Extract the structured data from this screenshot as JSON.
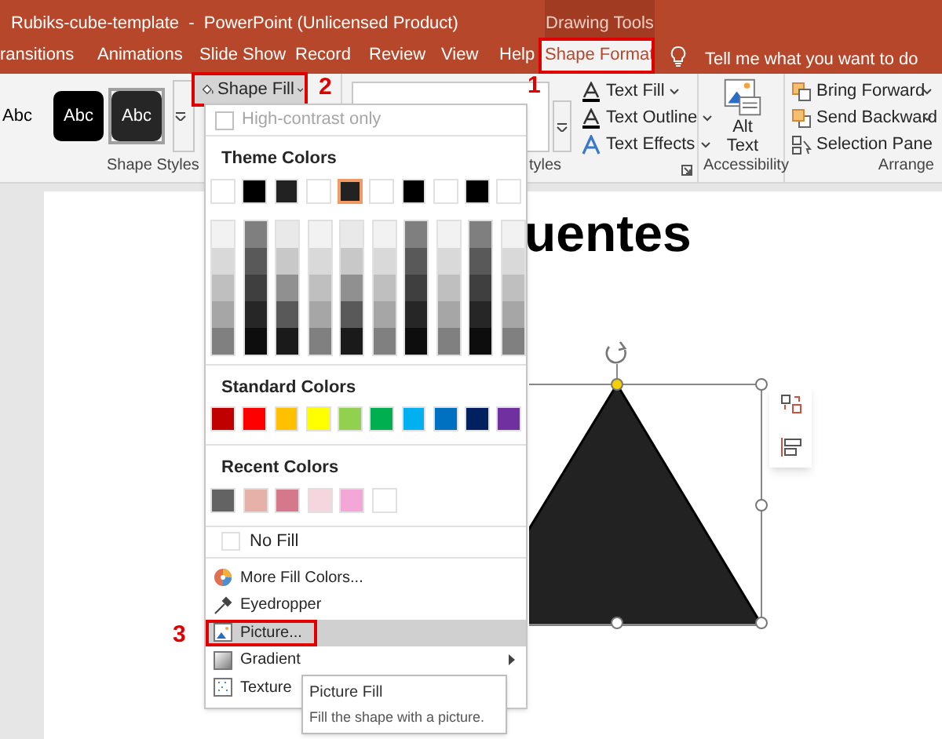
{
  "window": {
    "title": "Rubiks-cube-template  -  PowerPoint (Unlicensed Product)",
    "context_group": "Drawing Tools"
  },
  "tabs": [
    {
      "label": "ransitions",
      "selected": false,
      "annotated": false
    },
    {
      "label": "Animations",
      "selected": false,
      "annotated": false
    },
    {
      "label": "Slide Show",
      "selected": false,
      "annotated": false
    },
    {
      "label": "Record",
      "selected": false,
      "annotated": false
    },
    {
      "label": "Review",
      "selected": false,
      "annotated": false
    },
    {
      "label": "View",
      "selected": false,
      "annotated": false
    },
    {
      "label": "Help",
      "selected": false,
      "annotated": false
    },
    {
      "label": "Shape Format",
      "selected": true,
      "annotated": true
    }
  ],
  "tell_me": "Tell me what you want to do",
  "ribbon": {
    "shape_styles": {
      "label": "Shape Styles",
      "styles": [
        {
          "label": "Abc",
          "selected": false,
          "kind": "plain"
        },
        {
          "label": "Abc",
          "selected": false,
          "kind": "dark"
        },
        {
          "label": "Abc",
          "selected": true,
          "kind": "dark"
        }
      ],
      "shape_fill": {
        "label": "Shape Fill",
        "annotated": true
      }
    },
    "wordart": {
      "label": "tyles",
      "buttons": [
        "Text Fill",
        "Text Outline",
        "Text Effects"
      ]
    },
    "accessibility": {
      "label": "Accessibility",
      "alt_text": [
        "Alt",
        "Text"
      ]
    },
    "arrange": {
      "label": "Arrange",
      "buttons": [
        {
          "label": "Bring Forward",
          "dropdown": true
        },
        {
          "label": "Send Backward",
          "dropdown": true
        },
        {
          "label": "Selection Pane",
          "dropdown": false
        }
      ]
    }
  },
  "annotations": [
    {
      "label": "1"
    },
    {
      "label": "2"
    },
    {
      "label": "3"
    }
  ],
  "fill_menu": {
    "high_contrast": {
      "label": "High-contrast only",
      "checked": false,
      "disabled": true
    },
    "theme_heading": "Theme Colors",
    "theme_colors": [
      {
        "color": "#ffffff",
        "selected": false,
        "shades": [
          {
            "color": "#f2f2f2"
          },
          {
            "color": "#d9d9d9"
          },
          {
            "color": "#bfbfbf"
          },
          {
            "color": "#a6a6a6"
          },
          {
            "color": "#808080"
          }
        ]
      },
      {
        "color": "#000000",
        "selected": false,
        "shades": [
          {
            "color": "#7f7f7f"
          },
          {
            "color": "#595959"
          },
          {
            "color": "#3f3f3f"
          },
          {
            "color": "#262626"
          },
          {
            "color": "#0d0d0d"
          }
        ]
      },
      {
        "color": "#222222",
        "selected": false,
        "shades": [
          {
            "color": "#e9e9e9"
          },
          {
            "color": "#c8c8c8"
          },
          {
            "color": "#909090"
          },
          {
            "color": "#595959"
          },
          {
            "color": "#1a1a1a"
          }
        ]
      },
      {
        "color": "#ffffff",
        "selected": false,
        "shades": [
          {
            "color": "#f2f2f2"
          },
          {
            "color": "#d9d9d9"
          },
          {
            "color": "#bfbfbf"
          },
          {
            "color": "#a6a6a6"
          },
          {
            "color": "#808080"
          }
        ]
      },
      {
        "color": "#222222",
        "selected": true,
        "shades": [
          {
            "color": "#e9e9e9"
          },
          {
            "color": "#c8c8c8"
          },
          {
            "color": "#909090"
          },
          {
            "color": "#595959"
          },
          {
            "color": "#1a1a1a"
          }
        ]
      },
      {
        "color": "#ffffff",
        "selected": false,
        "shades": [
          {
            "color": "#f2f2f2"
          },
          {
            "color": "#d9d9d9"
          },
          {
            "color": "#bfbfbf"
          },
          {
            "color": "#a6a6a6"
          },
          {
            "color": "#808080"
          }
        ]
      },
      {
        "color": "#000000",
        "selected": false,
        "shades": [
          {
            "color": "#7f7f7f"
          },
          {
            "color": "#595959"
          },
          {
            "color": "#3f3f3f"
          },
          {
            "color": "#262626"
          },
          {
            "color": "#0d0d0d"
          }
        ]
      },
      {
        "color": "#ffffff",
        "selected": false,
        "shades": [
          {
            "color": "#f2f2f2"
          },
          {
            "color": "#d9d9d9"
          },
          {
            "color": "#bfbfbf"
          },
          {
            "color": "#a6a6a6"
          },
          {
            "color": "#808080"
          }
        ]
      },
      {
        "color": "#000000",
        "selected": false,
        "shades": [
          {
            "color": "#7f7f7f"
          },
          {
            "color": "#595959"
          },
          {
            "color": "#3f3f3f"
          },
          {
            "color": "#262626"
          },
          {
            "color": "#0d0d0d"
          }
        ]
      },
      {
        "color": "#ffffff",
        "selected": false,
        "shades": [
          {
            "color": "#f2f2f2"
          },
          {
            "color": "#d9d9d9"
          },
          {
            "color": "#bfbfbf"
          },
          {
            "color": "#a6a6a6"
          },
          {
            "color": "#808080"
          }
        ]
      }
    ],
    "standard_heading": "Standard Colors",
    "standard_colors": [
      {
        "color": "#c00000"
      },
      {
        "color": "#ff0000"
      },
      {
        "color": "#ffc000"
      },
      {
        "color": "#ffff00"
      },
      {
        "color": "#92d050"
      },
      {
        "color": "#00b050"
      },
      {
        "color": "#00b0f0"
      },
      {
        "color": "#0070c0"
      },
      {
        "color": "#002060"
      },
      {
        "color": "#7030a0"
      }
    ],
    "recent_heading": "Recent Colors",
    "recent_colors": [
      {
        "color": "#636363"
      },
      {
        "color": "#e6b1a9"
      },
      {
        "color": "#d6788b"
      },
      {
        "color": "#f5d5de"
      },
      {
        "color": "#f2a7d6"
      },
      {
        "color": "#ffffff"
      }
    ],
    "no_fill": "No Fill",
    "items": [
      {
        "kind": "palette",
        "label": "More Fill Colors...",
        "selected": false,
        "annotated": false,
        "submenu": false
      },
      {
        "kind": "eyedropper",
        "label": "Eyedropper",
        "selected": false,
        "annotated": false,
        "submenu": false
      },
      {
        "kind": "picture",
        "label": "Picture...",
        "selected": true,
        "annotated": true,
        "submenu": false
      },
      {
        "kind": "gradient",
        "label": "Gradient",
        "selected": false,
        "annotated": false,
        "submenu": true
      },
      {
        "kind": "texture",
        "label": "Texture",
        "selected": false,
        "annotated": false,
        "submenu": false
      }
    ]
  },
  "tooltip": {
    "title": "Picture Fill",
    "text": "Fill the shape with a picture."
  },
  "slide": {
    "title": "uentes"
  }
}
